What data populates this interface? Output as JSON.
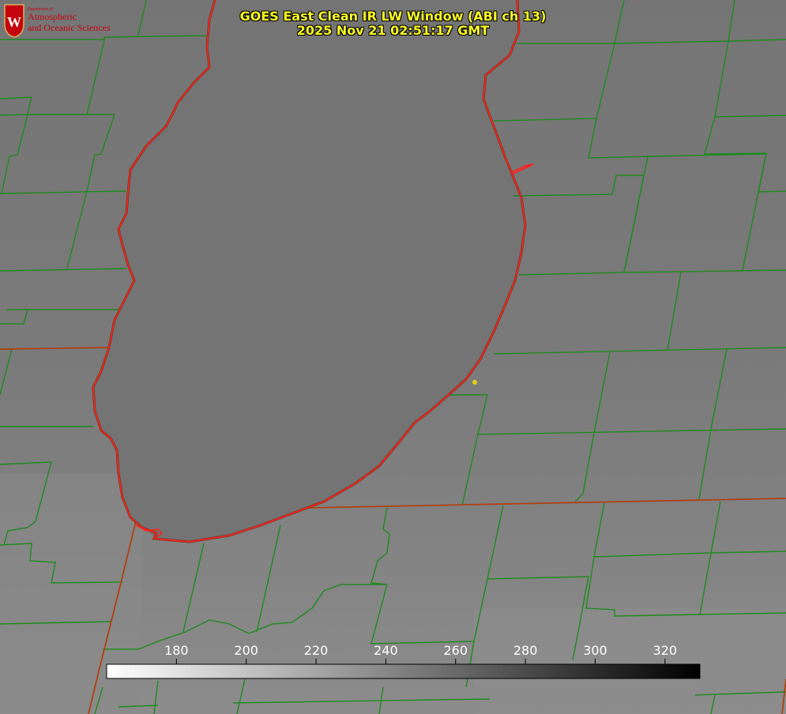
{
  "title": {
    "line1": "GOES East Clean IR LW Window (ABI ch 13)",
    "line2": "2025 Nov 21 02:51:17 GMT"
  },
  "logo": {
    "dept": "Department of",
    "line1": "Atmospheric",
    "line2": "and Oceanic Sciences",
    "emblem": "uw-crest-icon"
  },
  "colorbar": {
    "ticks": [
      "180",
      "200",
      "220",
      "240",
      "260",
      "280",
      "300",
      "320"
    ],
    "scale": {
      "min": 160,
      "max": 330,
      "min_color": "#ffffff",
      "max_color": "#000000"
    }
  },
  "colors": {
    "county_border": "#1f8a1f",
    "state_border": "#b04010",
    "coastline": "#ff2020",
    "marker": "#e0d010",
    "title_text": "#ffff22"
  },
  "map": {
    "description_type": "satellite-ir-lake-michigan",
    "marker_icon": "city-dot-icon"
  }
}
